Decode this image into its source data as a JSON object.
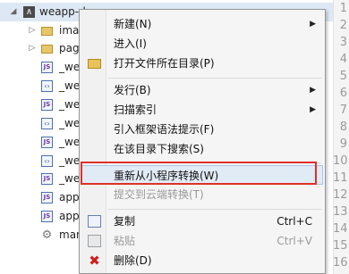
{
  "tree": {
    "root_label": "weapp-demo",
    "items": [
      {
        "label": "imag",
        "icon": "folder-icon"
      },
      {
        "label": "page",
        "icon": "folder-icon"
      },
      {
        "label": "_we",
        "icon": "js-file-icon"
      },
      {
        "label": "_we",
        "icon": "xml-file-icon"
      },
      {
        "label": "_we",
        "icon": "js-file-icon"
      },
      {
        "label": "_we",
        "icon": "xml-file-icon"
      },
      {
        "label": "_we",
        "icon": "js-file-icon"
      },
      {
        "label": "_we",
        "icon": "xml-file-icon"
      },
      {
        "label": "_we",
        "icon": "js-file-icon"
      },
      {
        "label": "app-",
        "icon": "js-file-icon"
      },
      {
        "label": "app-",
        "icon": "js-file-icon"
      },
      {
        "label": "man",
        "icon": "gear-icon"
      }
    ]
  },
  "gutter": {
    "line_numbers": [
      "1",
      "2",
      "3",
      "4",
      "5",
      "6",
      "7",
      "8",
      "9",
      "10",
      "11",
      "12",
      "13",
      "14",
      "15",
      "16"
    ]
  },
  "menu": {
    "items": [
      {
        "label": "新建(N)",
        "submenu": true
      },
      {
        "label": "进入(I)"
      },
      {
        "label": "打开文件所在目录(P)",
        "icon": "open-folder-icon"
      },
      {
        "label": "发行(B)",
        "submenu": true
      },
      {
        "label": "扫描索引",
        "submenu": true
      },
      {
        "label": "引入框架语法提示(F)"
      },
      {
        "label": "在该目录下搜索(S)"
      },
      {
        "label": "重新从小程序转换(W)",
        "highlighted": true
      },
      {
        "label": "提交到云端转换(T)",
        "disabled": true
      },
      {
        "label": "复制",
        "shortcut": "Ctrl+C",
        "icon": "copy-icon"
      },
      {
        "label": "粘贴",
        "shortcut": "Ctrl+V",
        "icon": "paste-icon",
        "disabled": true
      },
      {
        "label": "删除(D)",
        "icon": "delete-icon"
      }
    ]
  },
  "colors": {
    "highlight_border": "#e0302a",
    "menu_background": "#f5f5f5",
    "selected_row": "#dde8f4"
  }
}
